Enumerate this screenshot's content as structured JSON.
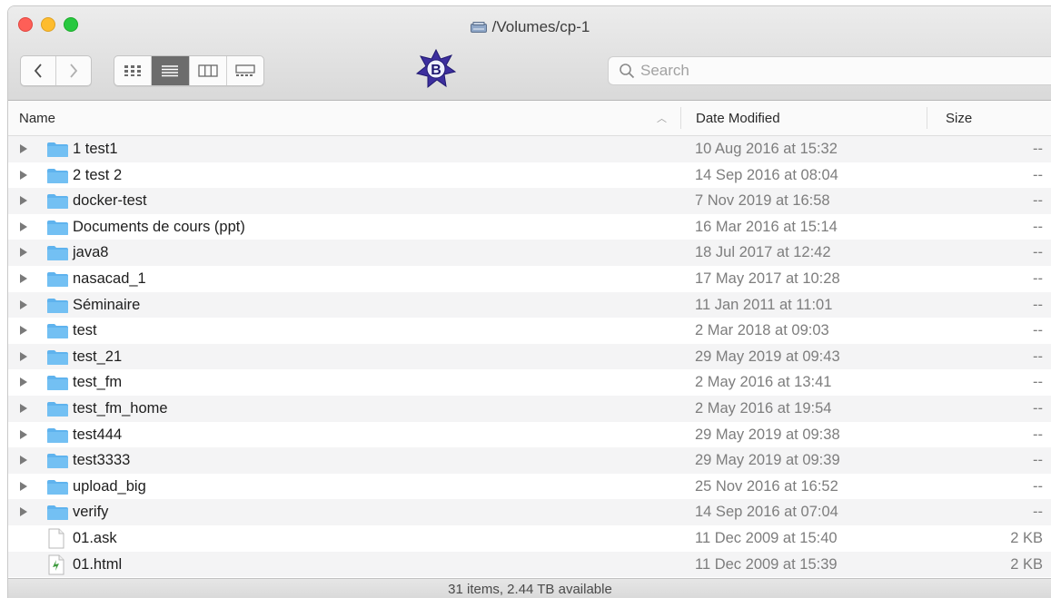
{
  "window": {
    "title": "/Volumes/cp-1"
  },
  "toolbar": {
    "back_icon": "chevron-left-icon",
    "forward_icon": "chevron-right-icon",
    "views": [
      "icon-view",
      "list-view",
      "column-view",
      "gallery-view"
    ],
    "active_view": "list-view",
    "app_icon": "bbedit-logo-icon",
    "search_placeholder": "Search"
  },
  "columns": {
    "name": "Name",
    "date": "Date Modified",
    "size": "Size"
  },
  "files": [
    {
      "name": "1 test1",
      "date": "10 Aug 2016 at 15:32",
      "size": "--",
      "type": "folder"
    },
    {
      "name": "2 test 2",
      "date": "14 Sep 2016 at 08:04",
      "size": "--",
      "type": "folder"
    },
    {
      "name": "docker-test",
      "date": "7 Nov 2019 at 16:58",
      "size": "--",
      "type": "folder"
    },
    {
      "name": "Documents de cours (ppt)",
      "date": "16 Mar 2016 at 15:14",
      "size": "--",
      "type": "folder"
    },
    {
      "name": "java8",
      "date": "18 Jul 2017 at 12:42",
      "size": "--",
      "type": "folder"
    },
    {
      "name": "nasacad_1",
      "date": "17 May 2017 at 10:28",
      "size": "--",
      "type": "folder"
    },
    {
      "name": "Séminaire",
      "date": "11 Jan 2011 at 11:01",
      "size": "--",
      "type": "folder"
    },
    {
      "name": "test",
      "date": "2 Mar 2018 at 09:03",
      "size": "--",
      "type": "folder"
    },
    {
      "name": "test_21",
      "date": "29 May 2019 at 09:43",
      "size": "--",
      "type": "folder"
    },
    {
      "name": "test_fm",
      "date": "2 May 2016 at 13:41",
      "size": "--",
      "type": "folder"
    },
    {
      "name": "test_fm_home",
      "date": "2 May 2016 at 19:54",
      "size": "--",
      "type": "folder"
    },
    {
      "name": "test444",
      "date": "29 May 2019 at 09:38",
      "size": "--",
      "type": "folder"
    },
    {
      "name": "test3333",
      "date": "29 May 2019 at 09:39",
      "size": "--",
      "type": "folder"
    },
    {
      "name": "upload_big",
      "date": "25 Nov 2016 at 16:52",
      "size": "--",
      "type": "folder"
    },
    {
      "name": "verify",
      "date": "14 Sep 2016 at 07:04",
      "size": "--",
      "type": "folder"
    },
    {
      "name": "01.ask",
      "date": "11 Dec 2009 at 15:40",
      "size": "2 KB",
      "type": "file"
    },
    {
      "name": "01.html",
      "date": "11 Dec 2009 at 15:39",
      "size": "2 KB",
      "type": "html"
    }
  ],
  "status": "31 items, 2.44 TB available",
  "colors": {
    "folder": "#5fb3ee",
    "alt_row": "#f4f4f5",
    "active_view": "#6c6c6c"
  }
}
